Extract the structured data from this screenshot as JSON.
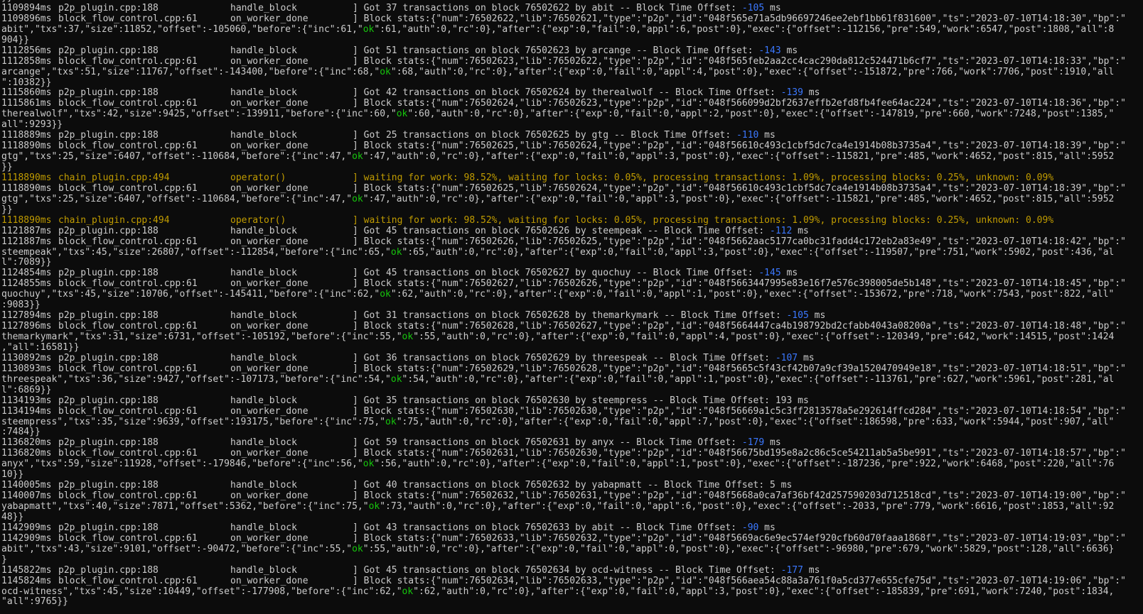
{
  "terminal": {
    "lines": [
      {
        "type": "wrap",
        "text": "}}"
      },
      {
        "type": "log",
        "ts": "1109894ms",
        "src": "p2p_plugin.cpp:188",
        "fn": "handle_block",
        "pre": "] Got 37 transactions on block 76502622 by abit -- Block Time Offset: ",
        "offset": "-105",
        "post": " ms"
      },
      {
        "type": "log",
        "ts": "1109896ms",
        "src": "block_flow_control.cpp:61",
        "fn": "on_worker_done",
        "pre": "] Block stats:{\"num\":76502622,\"lib\":76502621,\"type\":\"p2p\",\"id\":\"048f565e71a5db96697246ee2ebf1bb61f831600\",\"ts\":\"2023-07-10T14:18:30\",\"bp\":\""
      },
      {
        "type": "wrap",
        "text": "abit\",\"txs\":37,\"size\":11852,\"offset\":-105060,\"before\":{\"inc\":61,\"",
        "ok": "ok",
        "rest": "\":61,\"auth\":0,\"rc\":0},\"after\":{\"exp\":0,\"fail\":0,\"appl\":6,\"post\":0},\"exec\":{\"offset\":-112156,\"pre\":549,\"work\":6547,\"post\":1808,\"all\":8"
      },
      {
        "type": "wrap",
        "text": "904}}"
      },
      {
        "type": "log",
        "ts": "1112856ms",
        "src": "p2p_plugin.cpp:188",
        "fn": "handle_block",
        "pre": "] Got 51 transactions on block 76502623 by arcange -- Block Time Offset: ",
        "offset": "-143",
        "post": " ms"
      },
      {
        "type": "log",
        "ts": "1112858ms",
        "src": "block_flow_control.cpp:61",
        "fn": "on_worker_done",
        "pre": "] Block stats:{\"num\":76502623,\"lib\":76502622,\"type\":\"p2p\",\"id\":\"048f565feb2aa2cc4cac290da812c524471b6cf7\",\"ts\":\"2023-07-10T14:18:33\",\"bp\":\""
      },
      {
        "type": "wrap",
        "text": "arcange\",\"txs\":51,\"size\":11767,\"offset\":-143400,\"before\":{\"inc\":68,\"",
        "ok": "ok",
        "rest": "\":68,\"auth\":0,\"rc\":0},\"after\":{\"exp\":0,\"fail\":0,\"appl\":4,\"post\":0},\"exec\":{\"offset\":-151872,\"pre\":766,\"work\":7706,\"post\":1910,\"all"
      },
      {
        "type": "wrap",
        "text": "\":10382}}"
      },
      {
        "type": "log",
        "ts": "1115860ms",
        "src": "p2p_plugin.cpp:188",
        "fn": "handle_block",
        "pre": "] Got 42 transactions on block 76502624 by therealwolf -- Block Time Offset: ",
        "offset": "-139",
        "post": " ms"
      },
      {
        "type": "log",
        "ts": "1115861ms",
        "src": "block_flow_control.cpp:61",
        "fn": "on_worker_done",
        "pre": "] Block stats:{\"num\":76502624,\"lib\":76502623,\"type\":\"p2p\",\"id\":\"048f566099d2bf2637effb2efd8fb4fee64ac224\",\"ts\":\"2023-07-10T14:18:36\",\"bp\":\""
      },
      {
        "type": "wrap",
        "text": "therealwolf\",\"txs\":42,\"size\":9425,\"offset\":-139911,\"before\":{\"inc\":60,\"",
        "ok": "ok",
        "rest": "\":60,\"auth\":0,\"rc\":0},\"after\":{\"exp\":0,\"fail\":0,\"appl\":2,\"post\":0},\"exec\":{\"offset\":-147819,\"pre\":660,\"work\":7248,\"post\":1385,\""
      },
      {
        "type": "wrap",
        "text": "all\":9293}}"
      },
      {
        "type": "log",
        "ts": "1118889ms",
        "src": "p2p_plugin.cpp:188",
        "fn": "handle_block",
        "pre": "] Got 25 transactions on block 76502625 by gtg -- Block Time Offset: ",
        "offset": "-110",
        "post": " ms"
      },
      {
        "type": "log",
        "ts": "1118890ms",
        "src": "block_flow_control.cpp:61",
        "fn": "on_worker_done",
        "pre": "] Block stats:{\"num\":76502625,\"lib\":76502624,\"type\":\"p2p\",\"id\":\"048f56610c493c1cbf5dc7ca4e1914b08b3735a4\",\"ts\":\"2023-07-10T14:18:39\",\"bp\":\""
      },
      {
        "type": "wrap",
        "text": "gtg\",\"txs\":25,\"size\":6407,\"offset\":-110684,\"before\":{\"inc\":47,\"",
        "ok": "ok",
        "rest": "\":47,\"auth\":0,\"rc\":0},\"after\":{\"exp\":0,\"fail\":0,\"appl\":3,\"post\":0},\"exec\":{\"offset\":-115821,\"pre\":485,\"work\":4652,\"post\":815,\"all\":5952"
      },
      {
        "type": "wrap",
        "text": "}}"
      },
      {
        "type": "warn",
        "ts": "1118890ms",
        "src": "chain_plugin.cpp:494",
        "fn": "operator()",
        "pre": "] waiting for work: 98.52%, waiting for locks: 0.05%, processing transactions: 1.09%, processing blocks: 0.25%, unknown: 0.09%"
      },
      {
        "type": "log",
        "ts": "1118890ms",
        "src": "block_flow_control.cpp:61",
        "fn": "on_worker_done",
        "pre": "] Block stats:{\"num\":76502625,\"lib\":76502624,\"type\":\"p2p\",\"id\":\"048f56610c493c1cbf5dc7ca4e1914b08b3735a4\",\"ts\":\"2023-07-10T14:18:39\",\"bp\":\""
      },
      {
        "type": "wrap",
        "text": "gtg\",\"txs\":25,\"size\":6407,\"offset\":-110684,\"before\":{\"inc\":47,\"",
        "ok": "ok",
        "rest": "\":47,\"auth\":0,\"rc\":0},\"after\":{\"exp\":0,\"fail\":0,\"appl\":3,\"post\":0},\"exec\":{\"offset\":-115821,\"pre\":485,\"work\":4652,\"post\":815,\"all\":5952"
      },
      {
        "type": "wrap",
        "text": "}}"
      },
      {
        "type": "warn",
        "ts": "1118890ms",
        "src": "chain_plugin.cpp:494",
        "fn": "operator()",
        "pre": "] waiting for work: 98.52%, waiting for locks: 0.05%, processing transactions: 1.09%, processing blocks: 0.25%, unknown: 0.09%"
      },
      {
        "type": "log",
        "ts": "1121887ms",
        "src": "p2p_plugin.cpp:188",
        "fn": "handle_block",
        "pre": "] Got 45 transactions on block 76502626 by steempeak -- Block Time Offset: ",
        "offset": "-112",
        "post": " ms"
      },
      {
        "type": "log",
        "ts": "1121887ms",
        "src": "block_flow_control.cpp:61",
        "fn": "on_worker_done",
        "pre": "] Block stats:{\"num\":76502626,\"lib\":76502625,\"type\":\"p2p\",\"id\":\"048f5662aac5177ca0bc31fadd4c172eb2a83e49\",\"ts\":\"2023-07-10T14:18:42\",\"bp\":\""
      },
      {
        "type": "wrap",
        "text": "steempeak\",\"txs\":45,\"size\":26807,\"offset\":-112854,\"before\":{\"inc\":65,\"",
        "ok": "ok",
        "rest": "\":65,\"auth\":0,\"rc\":0},\"after\":{\"exp\":0,\"fail\":0,\"appl\":3,\"post\":0},\"exec\":{\"offset\":-119507,\"pre\":751,\"work\":5902,\"post\":436,\"al"
      },
      {
        "type": "wrap",
        "text": "l\":7089}}"
      },
      {
        "type": "log",
        "ts": "1124854ms",
        "src": "p2p_plugin.cpp:188",
        "fn": "handle_block",
        "pre": "] Got 45 transactions on block 76502627 by quochuy -- Block Time Offset: ",
        "offset": "-145",
        "post": " ms"
      },
      {
        "type": "log",
        "ts": "1124855ms",
        "src": "block_flow_control.cpp:61",
        "fn": "on_worker_done",
        "pre": "] Block stats:{\"num\":76502627,\"lib\":76502626,\"type\":\"p2p\",\"id\":\"048f5663447995e83e16f7e576c398005de5b148\",\"ts\":\"2023-07-10T14:18:45\",\"bp\":\""
      },
      {
        "type": "wrap",
        "text": "quochuy\",\"txs\":45,\"size\":10706,\"offset\":-145411,\"before\":{\"inc\":62,\"",
        "ok": "ok",
        "rest": "\":62,\"auth\":0,\"rc\":0},\"after\":{\"exp\":0,\"fail\":0,\"appl\":1,\"post\":0},\"exec\":{\"offset\":-153672,\"pre\":718,\"work\":7543,\"post\":822,\"all\""
      },
      {
        "type": "wrap",
        "text": ":9083}}"
      },
      {
        "type": "log",
        "ts": "1127894ms",
        "src": "p2p_plugin.cpp:188",
        "fn": "handle_block",
        "pre": "] Got 31 transactions on block 76502628 by themarkymark -- Block Time Offset: ",
        "offset": "-105",
        "post": " ms"
      },
      {
        "type": "log",
        "ts": "1127896ms",
        "src": "block_flow_control.cpp:61",
        "fn": "on_worker_done",
        "pre": "] Block stats:{\"num\":76502628,\"lib\":76502627,\"type\":\"p2p\",\"id\":\"048f5664447ca4b198792bd2cfabb4043a08200a\",\"ts\":\"2023-07-10T14:18:48\",\"bp\":\""
      },
      {
        "type": "wrap",
        "text": "themarkymark\",\"txs\":31,\"size\":6731,\"offset\":-105192,\"before\":{\"inc\":55,\"",
        "ok": "ok",
        "rest": "\":55,\"auth\":0,\"rc\":0},\"after\":{\"exp\":0,\"fail\":0,\"appl\":4,\"post\":0},\"exec\":{\"offset\":-120349,\"pre\":642,\"work\":14515,\"post\":1424"
      },
      {
        "type": "wrap",
        "text": ",\"all\":16581}}"
      },
      {
        "type": "log",
        "ts": "1130892ms",
        "src": "p2p_plugin.cpp:188",
        "fn": "handle_block",
        "pre": "] Got 36 transactions on block 76502629 by threespeak -- Block Time Offset: ",
        "offset": "-107",
        "post": " ms"
      },
      {
        "type": "log",
        "ts": "1130893ms",
        "src": "block_flow_control.cpp:61",
        "fn": "on_worker_done",
        "pre": "] Block stats:{\"num\":76502629,\"lib\":76502628,\"type\":\"p2p\",\"id\":\"048f5665c5f43cf42b07a9cf39a1520470949e18\",\"ts\":\"2023-07-10T14:18:51\",\"bp\":\""
      },
      {
        "type": "wrap",
        "text": "threespeak\",\"txs\":36,\"size\":9427,\"offset\":-107173,\"before\":{\"inc\":54,\"",
        "ok": "ok",
        "rest": "\":54,\"auth\":0,\"rc\":0},\"after\":{\"exp\":0,\"fail\":0,\"appl\":1,\"post\":0},\"exec\":{\"offset\":-113761,\"pre\":627,\"work\":5961,\"post\":281,\"al"
      },
      {
        "type": "wrap",
        "text": "l\":6869}}"
      },
      {
        "type": "log",
        "ts": "1134193ms",
        "src": "p2p_plugin.cpp:188",
        "fn": "handle_block",
        "pre": "] Got 35 transactions on block 76502630 by steempress -- Block Time Offset: 193 ms"
      },
      {
        "type": "log",
        "ts": "1134194ms",
        "src": "block_flow_control.cpp:61",
        "fn": "on_worker_done",
        "pre": "] Block stats:{\"num\":76502630,\"lib\":76502630,\"type\":\"p2p\",\"id\":\"048f56669a1c5c3ff2813578a5e292614ffcd284\",\"ts\":\"2023-07-10T14:18:54\",\"bp\":\""
      },
      {
        "type": "wrap",
        "text": "steempress\",\"txs\":35,\"size\":9639,\"offset\":193175,\"before\":{\"inc\":75,\"",
        "ok": "ok",
        "rest": "\":75,\"auth\":0,\"rc\":0},\"after\":{\"exp\":0,\"fail\":0,\"appl\":7,\"post\":0},\"exec\":{\"offset\":186598,\"pre\":633,\"work\":5944,\"post\":907,\"all\""
      },
      {
        "type": "wrap",
        "text": ":7484}}"
      },
      {
        "type": "log",
        "ts": "1136820ms",
        "src": "p2p_plugin.cpp:188",
        "fn": "handle_block",
        "pre": "] Got 59 transactions on block 76502631 by anyx -- Block Time Offset: ",
        "offset": "-179",
        "post": " ms"
      },
      {
        "type": "log",
        "ts": "1136820ms",
        "src": "block_flow_control.cpp:61",
        "fn": "on_worker_done",
        "pre": "] Block stats:{\"num\":76502631,\"lib\":76502630,\"type\":\"p2p\",\"id\":\"048f56675bd195e8a2c86c5ce54211ab5a5be991\",\"ts\":\"2023-07-10T14:18:57\",\"bp\":\""
      },
      {
        "type": "wrap",
        "text": "anyx\",\"txs\":59,\"size\":11928,\"offset\":-179846,\"before\":{\"inc\":56,\"",
        "ok": "ok",
        "rest": "\":56,\"auth\":0,\"rc\":0},\"after\":{\"exp\":0,\"fail\":0,\"appl\":1,\"post\":0},\"exec\":{\"offset\":-187236,\"pre\":922,\"work\":6468,\"post\":220,\"all\":76"
      },
      {
        "type": "wrap",
        "text": "10}}"
      },
      {
        "type": "log",
        "ts": "1140005ms",
        "src": "p2p_plugin.cpp:188",
        "fn": "handle_block",
        "pre": "] Got 40 transactions on block 76502632 by yabapmatt -- Block Time Offset: 5 ms"
      },
      {
        "type": "log",
        "ts": "1140007ms",
        "src": "block_flow_control.cpp:61",
        "fn": "on_worker_done",
        "pre": "] Block stats:{\"num\":76502632,\"lib\":76502631,\"type\":\"p2p\",\"id\":\"048f5668a0ca7af36bf42d257590203d712518cd\",\"ts\":\"2023-07-10T14:19:00\",\"bp\":\""
      },
      {
        "type": "wrap",
        "text": "yabapmatt\",\"txs\":40,\"size\":7871,\"offset\":5362,\"before\":{\"inc\":75,\"",
        "ok": "ok",
        "rest": "\":73,\"auth\":0,\"rc\":0},\"after\":{\"exp\":0,\"fail\":0,\"appl\":6,\"post\":0},\"exec\":{\"offset\":-2033,\"pre\":779,\"work\":6616,\"post\":1853,\"all\":92"
      },
      {
        "type": "wrap",
        "text": "48}}"
      },
      {
        "type": "log",
        "ts": "1142909ms",
        "src": "p2p_plugin.cpp:188",
        "fn": "handle_block",
        "pre": "] Got 43 transactions on block 76502633 by abit -- Block Time Offset: ",
        "offset": "-90",
        "post": " ms"
      },
      {
        "type": "log",
        "ts": "1142909ms",
        "src": "block_flow_control.cpp:61",
        "fn": "on_worker_done",
        "pre": "] Block stats:{\"num\":76502633,\"lib\":76502632,\"type\":\"p2p\",\"id\":\"048f5669ac6e9ec574ef920cfb60d70faaa1868f\",\"ts\":\"2023-07-10T14:19:03\",\"bp\":\""
      },
      {
        "type": "wrap",
        "text": "abit\",\"txs\":43,\"size\":9101,\"offset\":-90472,\"before\":{\"inc\":55,\"",
        "ok": "ok",
        "rest": "\":55,\"auth\":0,\"rc\":0},\"after\":{\"exp\":0,\"fail\":0,\"appl\":0,\"post\":0},\"exec\":{\"offset\":-96980,\"pre\":679,\"work\":5829,\"post\":128,\"all\":6636}"
      },
      {
        "type": "wrap",
        "text": "}"
      },
      {
        "type": "log",
        "ts": "1145822ms",
        "src": "p2p_plugin.cpp:188",
        "fn": "handle_block",
        "pre": "] Got 45 transactions on block 76502634 by ocd-witness -- Block Time Offset: ",
        "offset": "-177",
        "post": " ms"
      },
      {
        "type": "log",
        "ts": "1145824ms",
        "src": "block_flow_control.cpp:61",
        "fn": "on_worker_done",
        "pre": "] Block stats:{\"num\":76502634,\"lib\":76502633,\"type\":\"p2p\",\"id\":\"048f566aea54c88a3a761f0a5cd377e655cfe75d\",\"ts\":\"2023-07-10T14:19:06\",\"bp\":\""
      },
      {
        "type": "wrap",
        "text": "ocd-witness\",\"txs\":45,\"size\":10449,\"offset\":-177908,\"before\":{\"inc\":62,\"",
        "ok": "ok",
        "rest": "\":62,\"auth\":0,\"rc\":0},\"after\":{\"exp\":0,\"fail\":0,\"appl\":3,\"post\":0},\"exec\":{\"offset\":-185839,\"pre\":691,\"work\":7240,\"post\":1834,"
      },
      {
        "type": "wrap",
        "text": "\"all\":9765}}"
      }
    ]
  }
}
